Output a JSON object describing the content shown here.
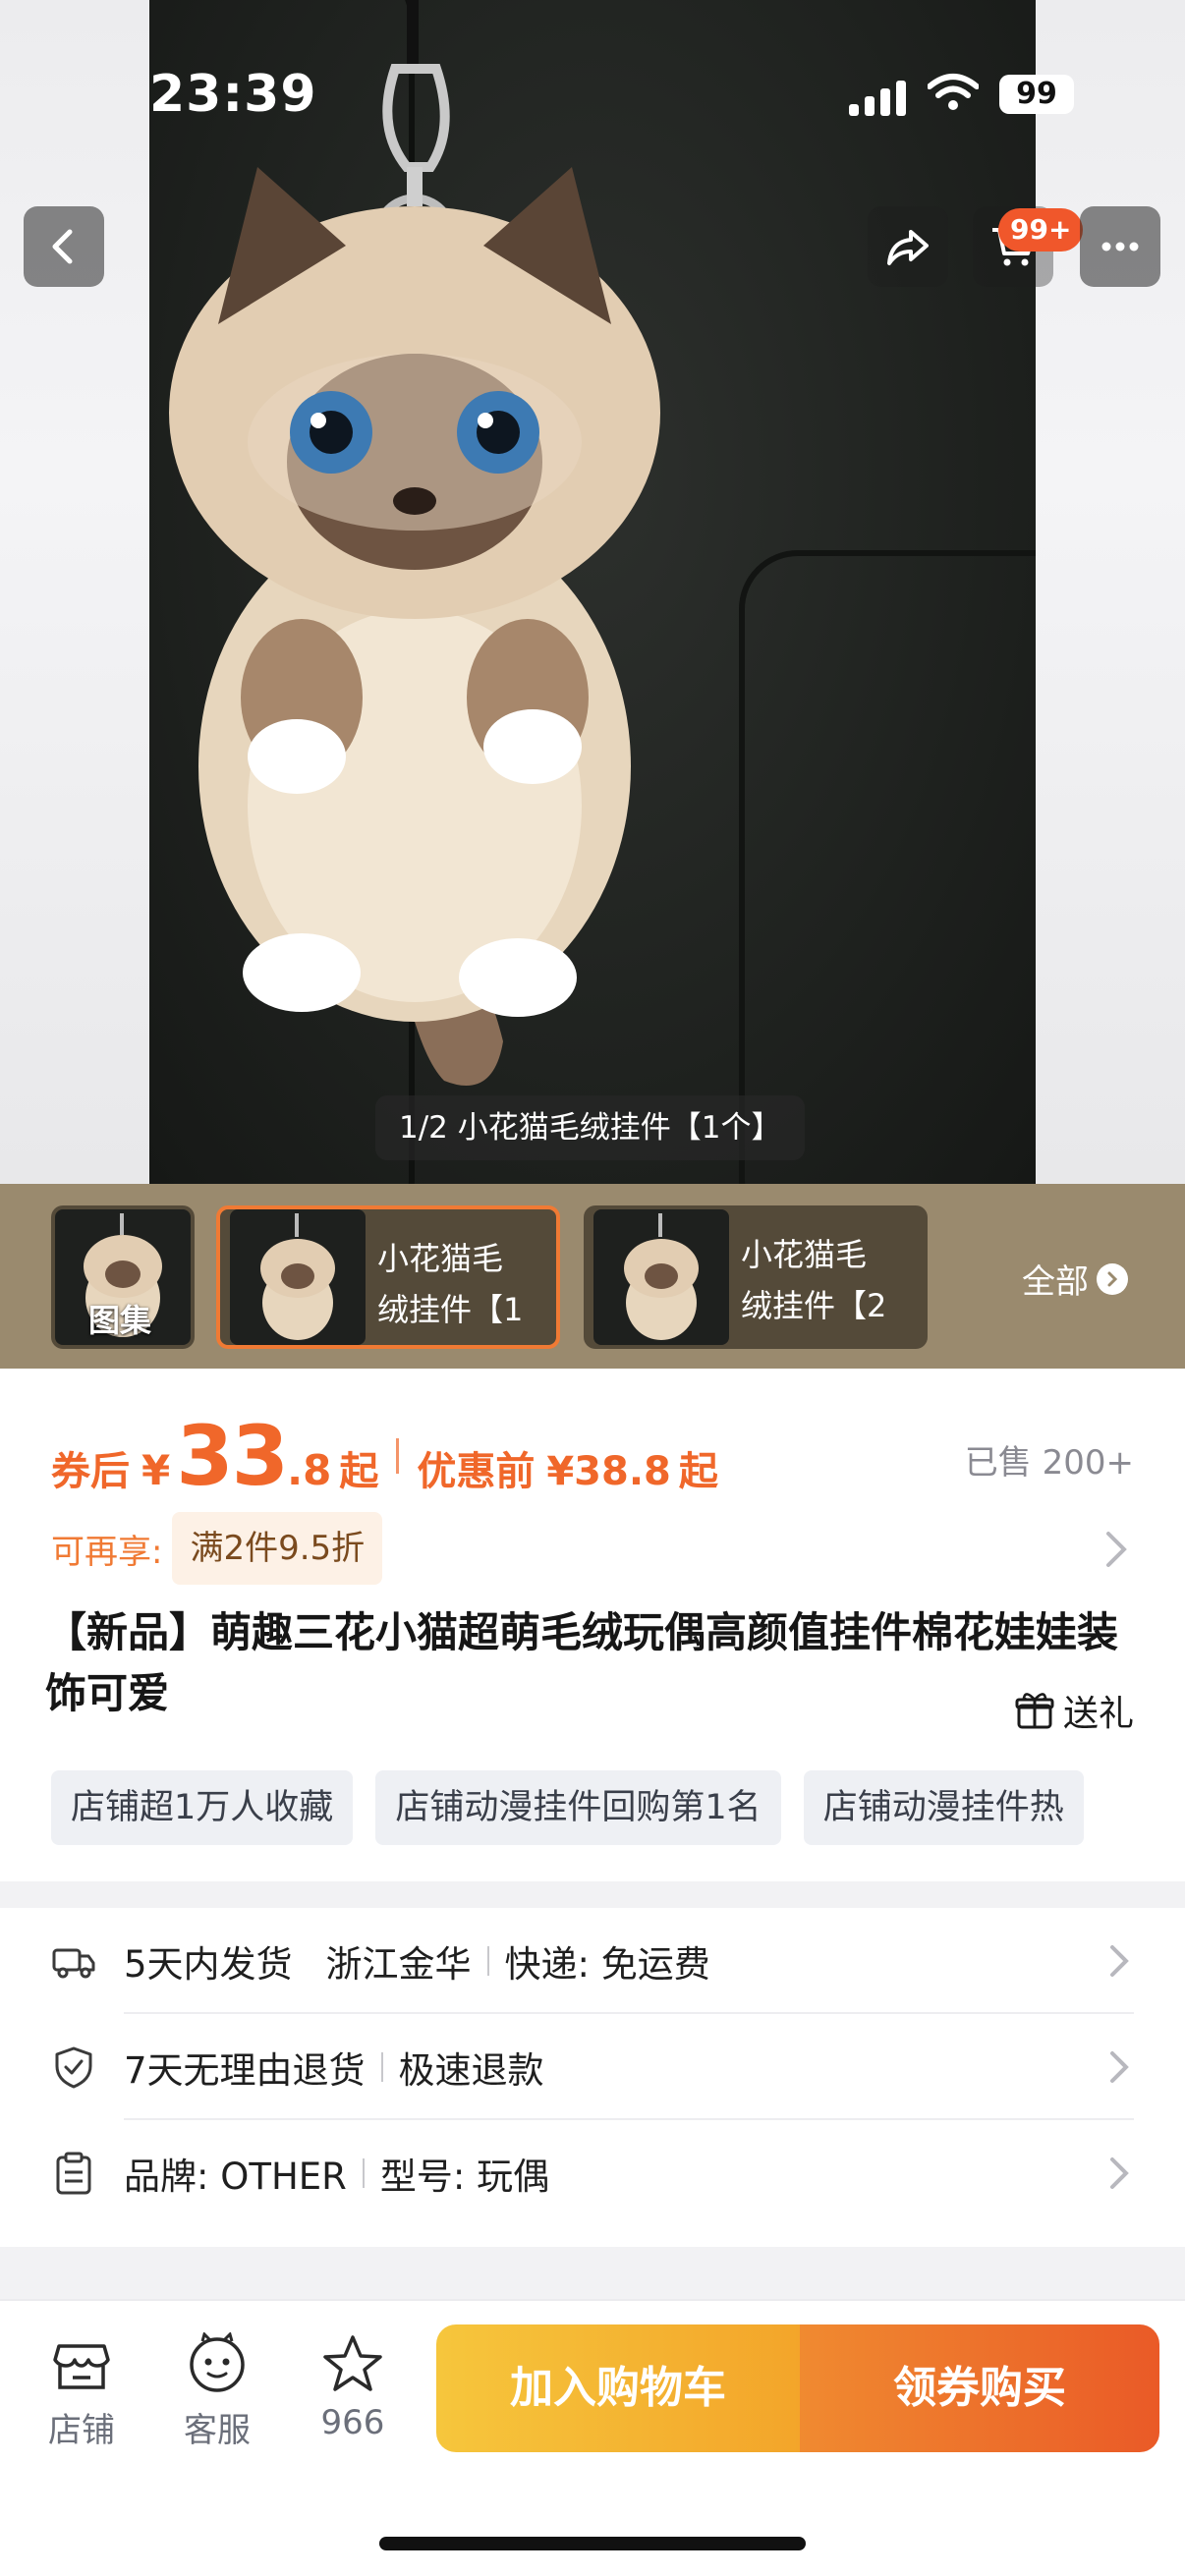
{
  "status": {
    "time": "23:39",
    "battery": "99"
  },
  "header": {
    "cart_badge": "99+"
  },
  "gallery": {
    "caption": "1/2 小花猫毛绒挂件【1个】",
    "thumbs": [
      "图集",
      "小花猫毛绒挂件【1",
      "小花猫毛绒挂件【2"
    ],
    "all_label": "全部"
  },
  "price": {
    "after_coupon_label": "券后",
    "currency": "¥",
    "int": "33",
    "dec": ".8",
    "qi": "起",
    "before_label": "优惠前",
    "before_price": "¥38.8",
    "before_qi": "起",
    "sold": "已售 200+"
  },
  "promo": {
    "label": "可再享:",
    "tag": "满2件9.5折"
  },
  "product": {
    "title": "【新品】萌趣三花小猫超萌毛绒玩偶高颜值挂件棉花娃娃装饰可爱",
    "gift": "送礼",
    "tags": [
      "店铺超1万人收藏",
      "店铺动漫挂件回购第1名",
      "店铺动漫挂件热"
    ]
  },
  "service": {
    "rows": [
      {
        "parts": [
          "5天内发货",
          "浙江金华",
          "快递: 免运费"
        ]
      },
      {
        "parts": [
          "7天无理由退货",
          "极速退款"
        ]
      },
      {
        "parts": [
          "品牌: OTHER",
          "型号: 玩偶"
        ]
      }
    ]
  },
  "bottom": {
    "shop": "店铺",
    "service": "客服",
    "fav_count": "966",
    "add_cart": "加入购物车",
    "buy": "领券购买"
  },
  "colors": {
    "accent": "#f0672a",
    "cart_button": "#f6c63c",
    "buy_button": "#ea5a27"
  }
}
